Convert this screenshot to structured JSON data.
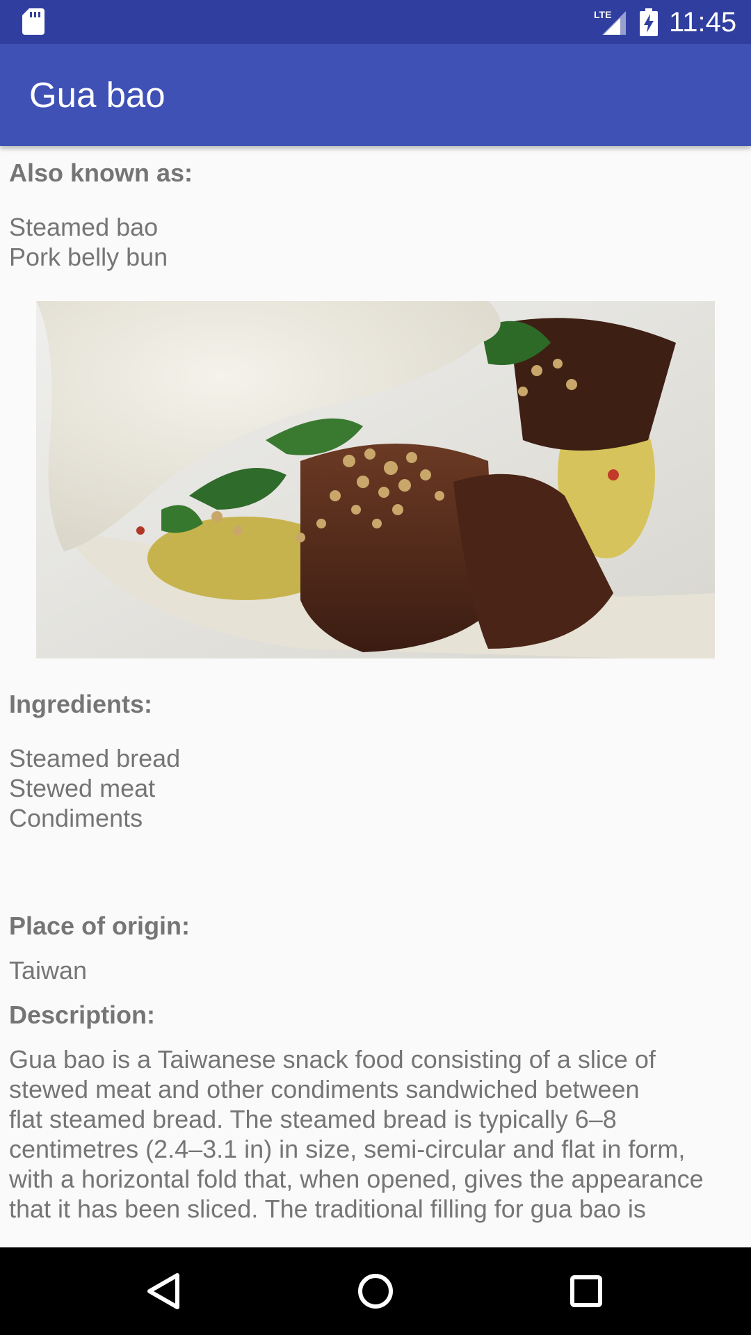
{
  "status_bar": {
    "time": "11:45",
    "network": "LTE",
    "icons": [
      "sd-card-icon",
      "lte-signal-icon",
      "battery-charging-icon"
    ]
  },
  "app_bar": {
    "title": "Gua bao",
    "color": "#3f51b5"
  },
  "sections": {
    "also_known_as": {
      "label": "Also known as:",
      "value": "Steamed bao\nPork belly bun"
    },
    "ingredients": {
      "label": "Ingredients:",
      "value": "Steamed bread\nStewed meat\nCondiments"
    },
    "place_of_origin": {
      "label": "Place of origin:",
      "value": "Taiwan"
    },
    "description": {
      "label": "Description:",
      "value": "Gua bao is a Taiwanese snack food consisting of a slice of\nstewed meat and other condiments sandwiched between\nflat steamed bread. The steamed bread is typically 6–8\ncentimetres (2.4–3.1 in) in size, semi-circular and flat in form,\nwith a horizontal fold that, when opened, gives the appearance\nthat it has been sliced. The traditional filling for gua bao is"
    }
  },
  "nav_bar": {
    "icons": [
      "back-icon",
      "home-icon",
      "recents-icon"
    ]
  }
}
